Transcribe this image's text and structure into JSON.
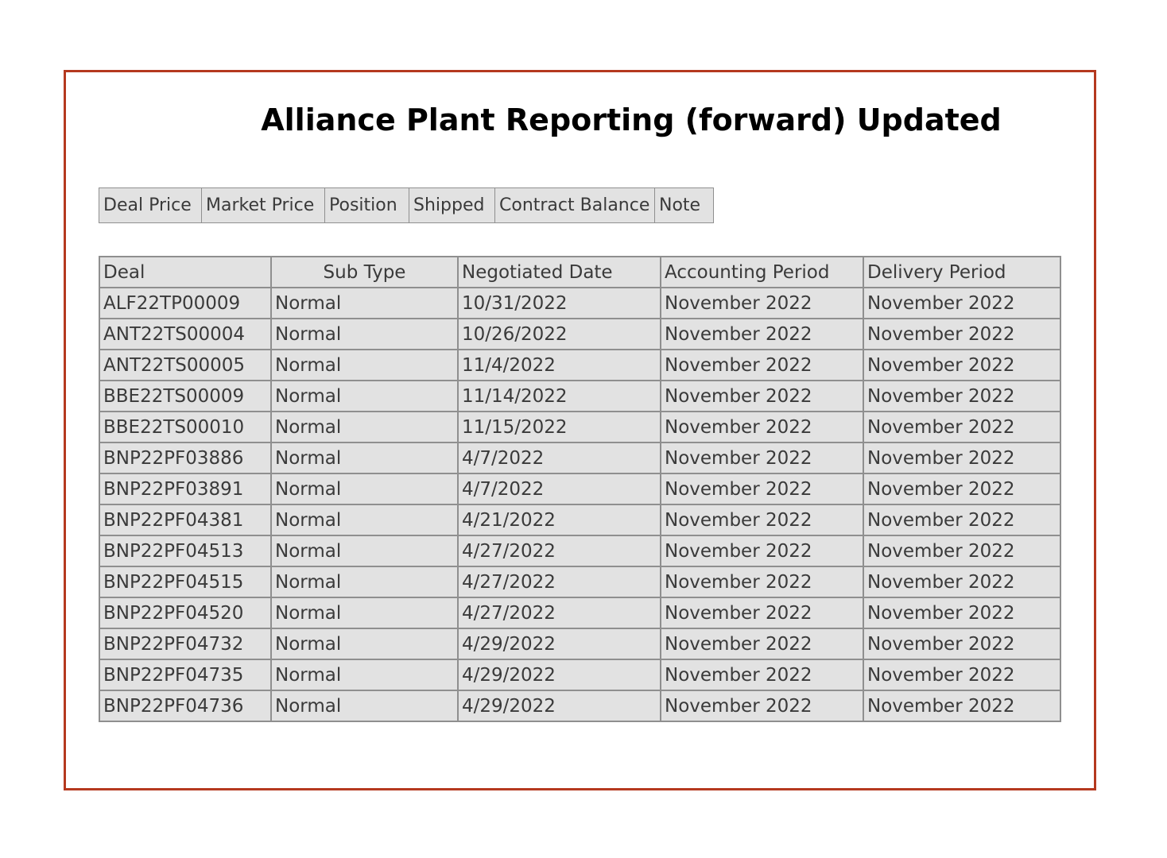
{
  "page": {
    "title": "Alliance Plant Reporting (forward) Updated"
  },
  "column_toggles": [
    "Deal Price",
    "Market Price",
    "Position",
    "Shipped",
    "Contract Balance",
    "Note"
  ],
  "table": {
    "headers": [
      "Deal",
      "Sub Type",
      "Negotiated Date",
      "Accounting Period",
      "Delivery Period"
    ],
    "rows": [
      [
        "ALF22TP00009",
        "Normal",
        "10/31/2022",
        "November 2022",
        "November 2022"
      ],
      [
        "ANT22TS00004",
        "Normal",
        "10/26/2022",
        "November 2022",
        "November 2022"
      ],
      [
        "ANT22TS00005",
        "Normal",
        "11/4/2022",
        "November 2022",
        "November 2022"
      ],
      [
        "BBE22TS00009",
        "Normal",
        "11/14/2022",
        "November 2022",
        "November 2022"
      ],
      [
        "BBE22TS00010",
        "Normal",
        "11/15/2022",
        "November 2022",
        "November 2022"
      ],
      [
        "BNP22PF03886",
        "Normal",
        "4/7/2022",
        "November 2022",
        "November 2022"
      ],
      [
        "BNP22PF03891",
        "Normal",
        "4/7/2022",
        "November 2022",
        "November 2022"
      ],
      [
        "BNP22PF04381",
        "Normal",
        "4/21/2022",
        "November 2022",
        "November 2022"
      ],
      [
        "BNP22PF04513",
        "Normal",
        "4/27/2022",
        "November 2022",
        "November 2022"
      ],
      [
        "BNP22PF04515",
        "Normal",
        "4/27/2022",
        "November 2022",
        "November 2022"
      ],
      [
        "BNP22PF04520",
        "Normal",
        "4/27/2022",
        "November 2022",
        "November 2022"
      ],
      [
        "BNP22PF04732",
        "Normal",
        "4/29/2022",
        "November 2022",
        "November 2022"
      ],
      [
        "BNP22PF04735",
        "Normal",
        "4/29/2022",
        "November 2022",
        "November 2022"
      ],
      [
        "BNP22PF04736",
        "Normal",
        "4/29/2022",
        "November 2022",
        "November 2022"
      ]
    ]
  },
  "colors": {
    "frame_border": "#b5391f",
    "cell_background": "#e2e2e2",
    "cell_border": "#8f8f8f",
    "text": "#3a3a3a"
  }
}
